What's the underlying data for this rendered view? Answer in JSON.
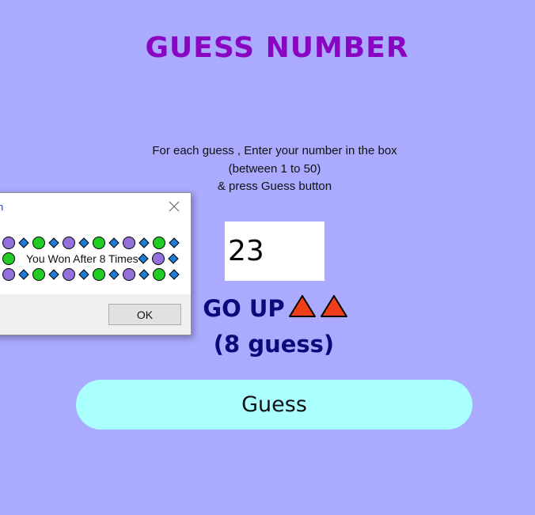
{
  "page": {
    "title": "GUESS NUMBER",
    "instructions": [
      "For each guess , Enter your number in the box",
      "(between 1 to 50)",
      "& press Guess button"
    ]
  },
  "input": {
    "value": "23"
  },
  "hint": {
    "text": "GO UP",
    "icons": [
      "up-triangle-icon",
      "up-triangle-icon"
    ],
    "guess_count_text": "(8 guess)"
  },
  "guess_button": {
    "label": "Guess"
  },
  "dialog": {
    "title_fragment": "n",
    "message": "You Won After 8 Times",
    "ok_label": "OK",
    "decoration_icons": [
      "purple-circle-icon",
      "blue-diamond-icon",
      "green-circle-icon"
    ]
  },
  "colors": {
    "background": "#aaaaff",
    "title": "#8a05c2",
    "hint_text": "#0a0a7a",
    "guess_button_bg": "#aaffff",
    "triangle_fill": "#f03d1a",
    "circle_purple": "#9370db",
    "circle_green": "#22cc22",
    "diamond_blue": "#1e7bd6"
  }
}
